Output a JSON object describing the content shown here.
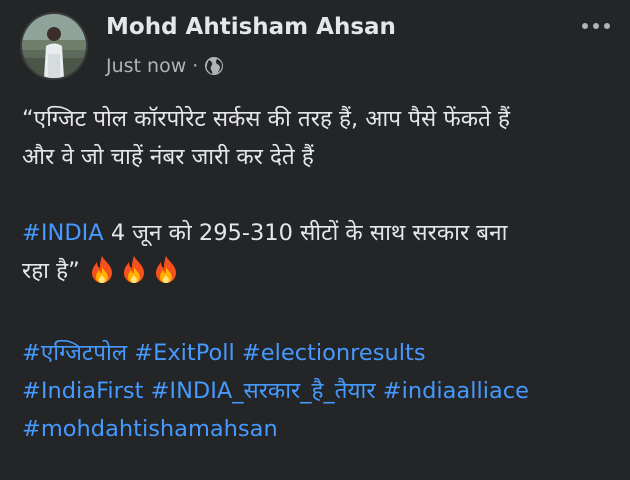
{
  "post": {
    "author": "Mohd Ahtisham Ahsan",
    "timestamp": "Just now",
    "separator": "·",
    "privacy_icon": "globe-icon",
    "more_icon": "more-horizontal-icon",
    "line1a": "“एग्जिट पोल कॉरपोरेट सर्कस की तरह हैं, आप पैसे फेंकते हैं",
    "line1b": "और वे जो चाहें नंबर जारी कर देते हैं",
    "hashtag_india": "#INDIA",
    "line2a": " 4 जून को 295-310 सीटों के साथ सरकार बना",
    "line2b": "रहा है”",
    "fire_icon": "fire-emoji-icon",
    "tags": {
      "t1": "#एग्जिटपोल",
      "t2": "#ExitPoll",
      "t3": "#electionresults",
      "t4": "#IndiaFirst",
      "t5": "#INDIA_सरकार_है_तैयार",
      "t6": "#indiaalliace",
      "t7": "#mohdahtishamahsan"
    }
  },
  "colors": {
    "background": "#242526",
    "text": "#e4e6eb",
    "secondary_text": "#b0b3b8",
    "hashtag": "#4599ff"
  }
}
